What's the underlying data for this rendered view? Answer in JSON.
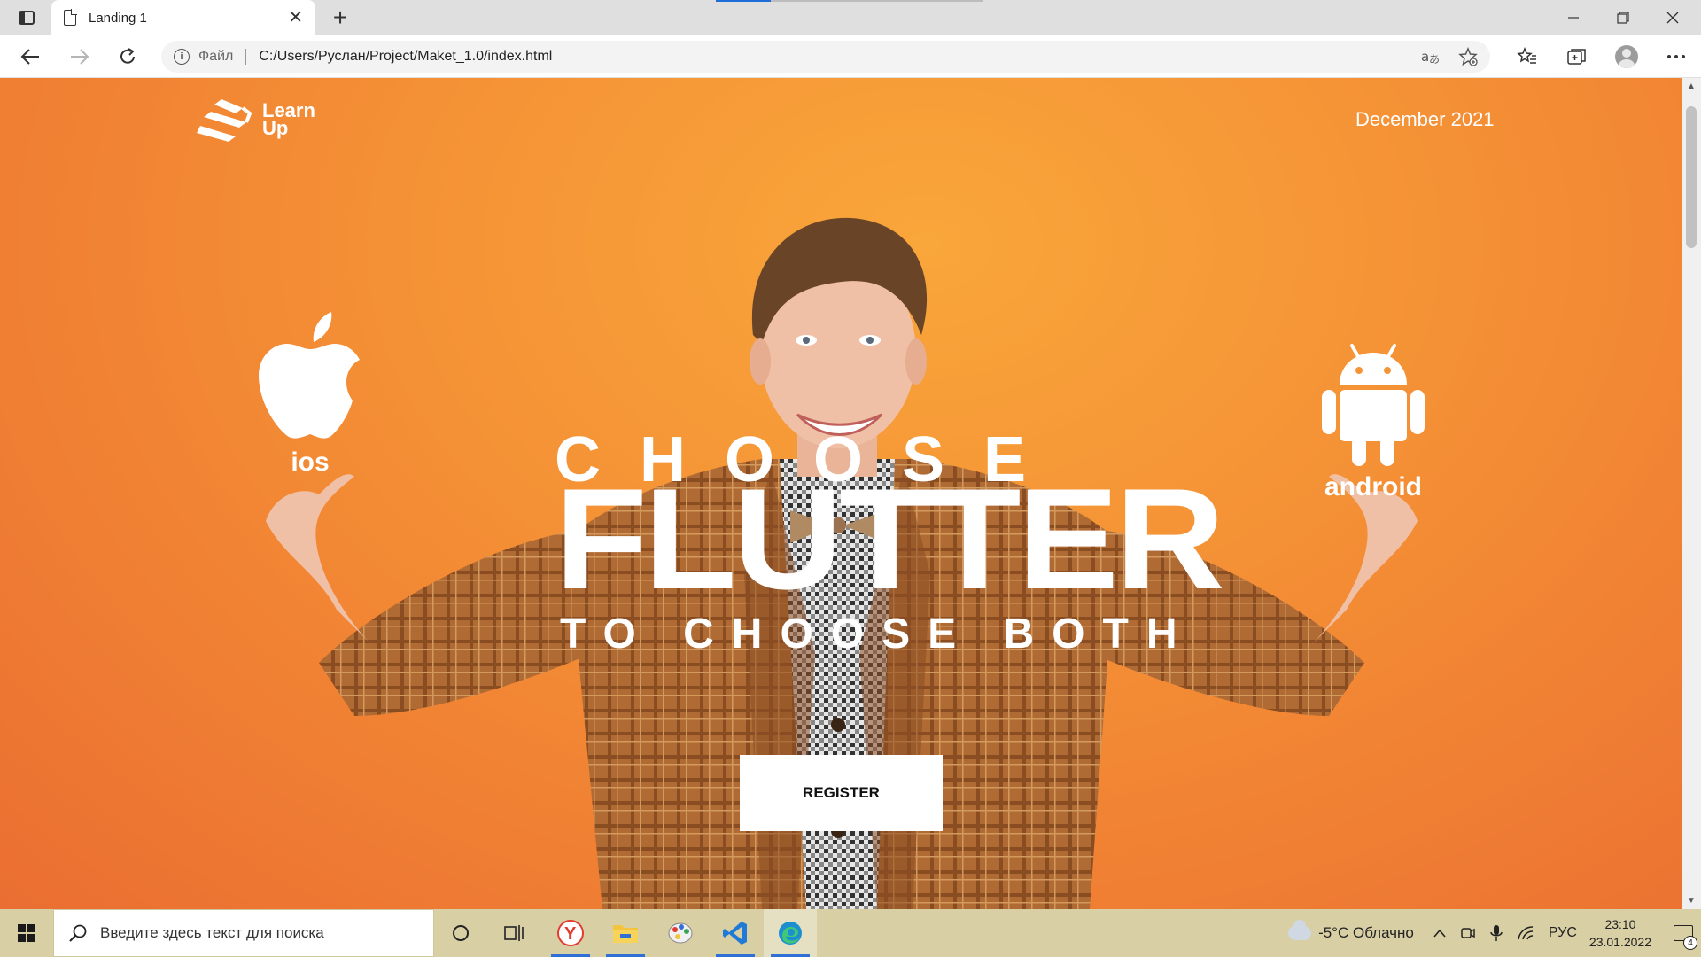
{
  "browser": {
    "tab_title": "Landing 1",
    "tab_close": "✕",
    "new_tab": "+",
    "scheme_label": "Файл",
    "url": "C:/Users/Руслан/Project/Maket_1.0/index.html"
  },
  "page": {
    "logo_line1": "Learn",
    "logo_line2": "Up",
    "date": "December 2021",
    "ios_label": "ios",
    "android_label": "android",
    "headline_top": "CHOOSE",
    "headline_main": "FLUTTER",
    "headline_bottom": "TO CHOOSE BOTH",
    "register_label": "REGISTER"
  },
  "taskbar": {
    "search_placeholder": "Введите здесь текст для поиска",
    "weather": "-5°C  Облачно",
    "language": "РУС",
    "time": "23:10",
    "date": "23.01.2022",
    "notification_count": "4"
  },
  "colors": {
    "hero_orange": "#f59436",
    "hero_dark_orange": "#ea6e32",
    "accent_blue": "#1d6ed8"
  }
}
